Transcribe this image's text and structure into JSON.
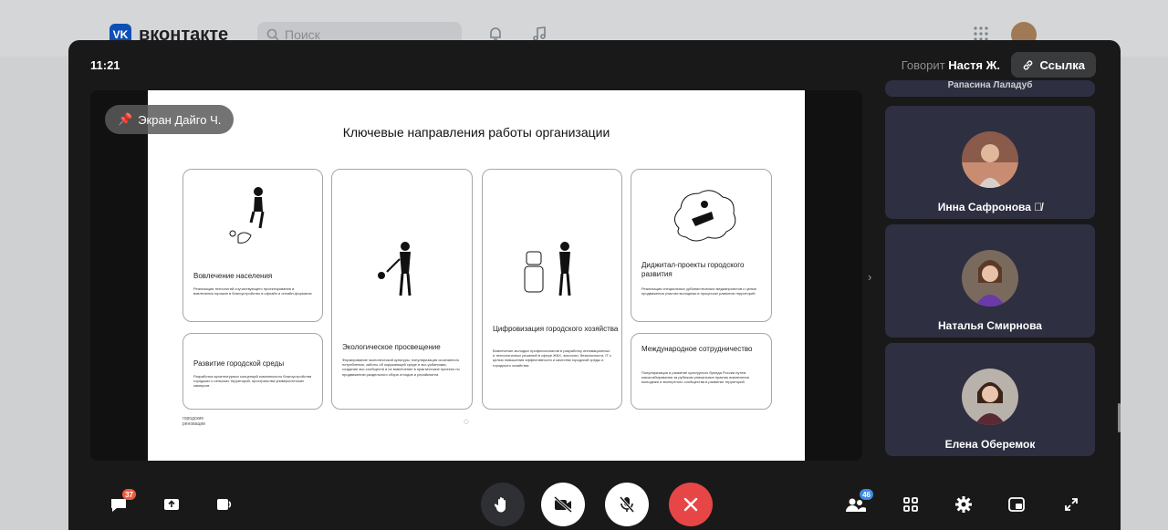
{
  "background": {
    "brand": "вконтакте",
    "brand_mark": "VK",
    "search_placeholder": "Поиск",
    "search_icon": "magnifier",
    "notification_icon": "bell",
    "music_icon": "note",
    "apps_icon": "grid"
  },
  "call": {
    "time": "11:21",
    "speaker_prefix": "Говорит",
    "speaker_name": "Настя Ж.",
    "link_label": "Ссылка",
    "screen_label": "Экран Дайго Ч."
  },
  "slide": {
    "title": "Ключевые направления работы организации",
    "brand": "городские\nреновации",
    "cards": [
      {
        "title": "Вовлечение населения",
        "text": "Реализация технологий соучаствующего проектирования и вовлечения горожан в благоустройство в офлайн и онлайн-форматах"
      },
      {
        "title": "Развитие городской среды",
        "text": "Разработка архитектурных концепций комплексного благоустройства городских и сельских территорий, пространства университетских кампусов"
      },
      {
        "title": "Экологическое просвещение",
        "text": "Формирование экологической культуры, популяризация осознанного потребления, заботы об окружающей среде и эко-урбанизма, создание эко-сообществ и их вовлечение в практические проекты по продвижению раздельного сбора отходов и ресайклинга"
      },
      {
        "title": "Цифровизация городского хозяйства",
        "text": "Вовлечение молодых профессионалов в разработку инновационных и технологичных решений в сфере ЖКХ, экологии, безопасности, IT с целью повышения эффективности и качества городской среды и городского хозяйства"
      },
      {
        "title": "Диджитал-проекты городского развития",
        "text": "Реализация специальных урбанистических медиапроектов с целью продвижения участия молодежи в процессах развития территорий"
      },
      {
        "title": "Международное сотрудничество",
        "text": "Популяризация и развитие культурного бренда России путем масштабирования за рубежом уникальных практик вовлечения молодежи и экспертного сообщества в развитие территорий"
      }
    ]
  },
  "participants": [
    {
      "name": "Рапасина Лаладуб",
      "muted": true
    },
    {
      "name": "Инна Сафронова",
      "muted": true
    },
    {
      "name": "Наталья Смирнова",
      "muted": false
    },
    {
      "name": "Елена Оберемок",
      "muted": false
    }
  ],
  "toolbar": {
    "chat_badge": "37",
    "participants_badge": "46",
    "colors": {
      "end_call": "#e64646",
      "badge_chat": "#f05a3c",
      "badge_people": "#3f8ae0"
    }
  }
}
